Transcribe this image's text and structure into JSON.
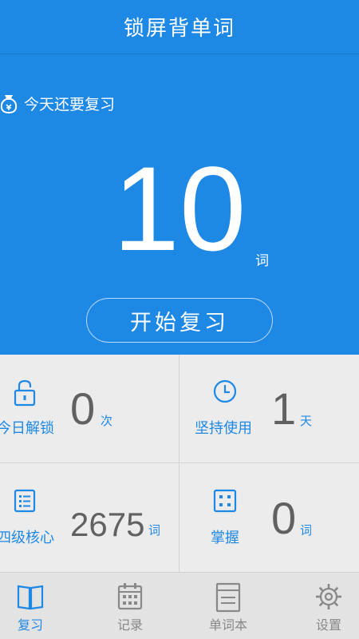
{
  "header": {
    "title": "锁屏背单词"
  },
  "hero": {
    "reminder_label": "今天还要复习",
    "count": "10",
    "unit": "词",
    "start_button": "开始复习"
  },
  "stats": [
    {
      "label": "今日解锁",
      "value": "0",
      "unit": "次",
      "icon": "lock-icon"
    },
    {
      "label": "坚持使用",
      "value": "1",
      "unit": "天",
      "icon": "clock-icon"
    },
    {
      "label": "四级核心",
      "value": "2675",
      "unit": "词",
      "icon": "list-icon"
    },
    {
      "label": "掌握",
      "value": "0",
      "unit": "词",
      "icon": "dice-icon"
    }
  ],
  "tabs": [
    {
      "label": "复习",
      "icon": "book-icon",
      "active": true
    },
    {
      "label": "记录",
      "icon": "calendar-icon",
      "active": false
    },
    {
      "label": "单词本",
      "icon": "notebook-icon",
      "active": false
    },
    {
      "label": "设置",
      "icon": "gear-icon",
      "active": false
    }
  ],
  "colors": {
    "primary": "#1e88e5",
    "value_text": "#616161",
    "background": "#ececec",
    "tab_inactive": "#888888"
  }
}
